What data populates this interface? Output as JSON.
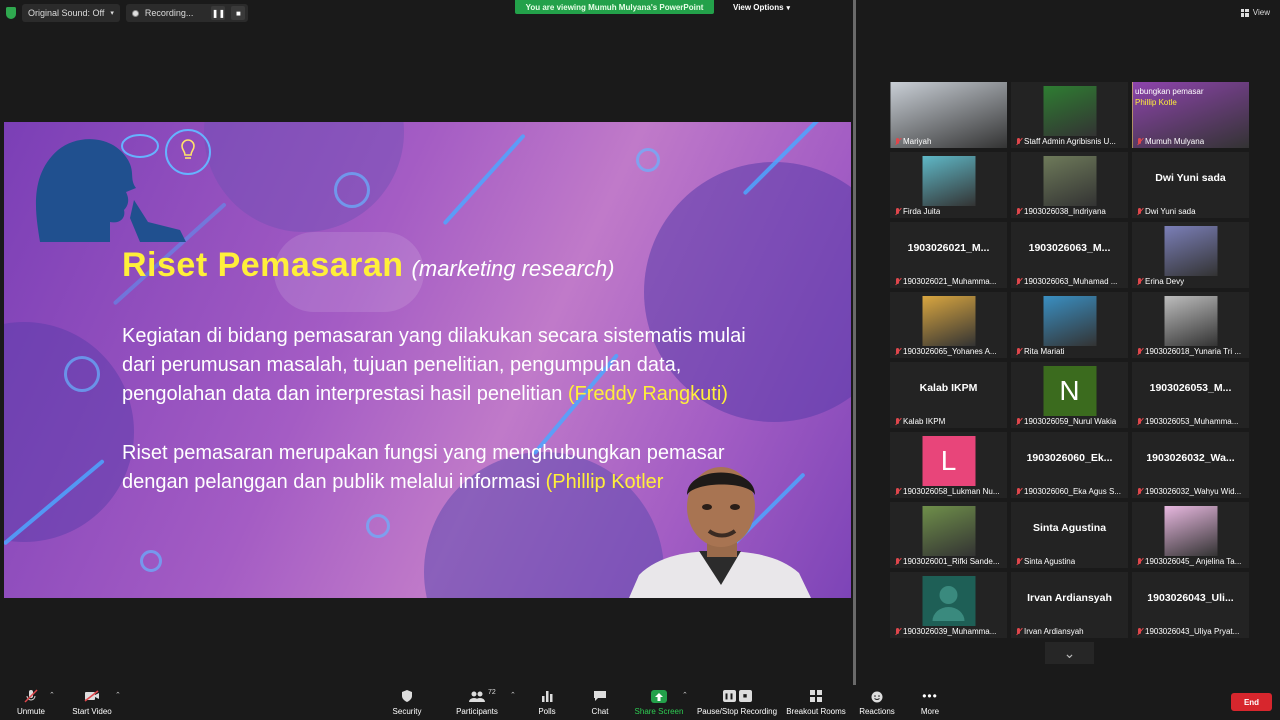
{
  "topbar": {
    "original_sound": "Original Sound: Off",
    "recording": "Recording...",
    "viewing_banner": "You are viewing Mumuh Mulyana's PowerPoint",
    "view_options": "View Options",
    "view": "View"
  },
  "slide": {
    "title": "Riset Pemasaran",
    "title_sub": "(marketing research)",
    "para1": "Kegiatan di bidang pemasaran yang dilakukan secara sistematis mulai dari perumusan masalah, tujuan penelitian, pengumpulan data, pengolahan data dan interprestasi hasil penelitian",
    "ref1": "(Freddy Rangkuti)",
    "para2": "Riset pemasaran merupakan fungsi yang menghubungkan pemasar dengan pelanggan dan publik melalui informasi",
    "ref2": "(Phillip Kotler"
  },
  "participants": [
    {
      "name": "Mariyah",
      "type": "photo",
      "color": "#c9cfd6"
    },
    {
      "name": "Staff Admin Agribisnis U...",
      "type": "photo",
      "color": "#2e7d32"
    },
    {
      "name": "Mumuh Mulyana",
      "type": "photo",
      "color": "#8e44ad",
      "overlay": "ubungkan pemasar",
      "overlay2": "Phillip Kotle"
    },
    {
      "name": "Firda Juita",
      "type": "photo",
      "color": "#5fb8c7"
    },
    {
      "name": "1903026038_Indriyana",
      "type": "photo",
      "color": "#6e7a5a"
    },
    {
      "name": "Dwi Yuni sada",
      "type": "text",
      "big": "Dwi Yuni sada"
    },
    {
      "name": "1903026021_Muhamma...",
      "type": "text",
      "big": "1903026021_M..."
    },
    {
      "name": "1903026063_Muhamad ...",
      "type": "text",
      "big": "1903026063_M..."
    },
    {
      "name": "Erina Devy",
      "type": "photo",
      "color": "#7b7fb8"
    },
    {
      "name": "1903026065_Yohanes A...",
      "type": "photo",
      "color": "#d9a640"
    },
    {
      "name": "Rita Mariati",
      "type": "photo",
      "color": "#3a8fc2"
    },
    {
      "name": "1903026018_Yunaria Tri ...",
      "type": "photo",
      "color": "#bdbdbd"
    },
    {
      "name": "Kalab IKPM",
      "type": "text",
      "big": "Kalab IKPM"
    },
    {
      "name": "1903026059_Nurul Wakia",
      "type": "letter",
      "letter": "N",
      "color": "#3b6b1e"
    },
    {
      "name": "1903026053_Muhamma...",
      "type": "text",
      "big": "1903026053_M..."
    },
    {
      "name": "1903026058_Lukman Nu...",
      "type": "letter",
      "letter": "L",
      "color": "#e8457a"
    },
    {
      "name": "1903026060_Eka Agus S...",
      "type": "text",
      "big": "1903026060_Ek..."
    },
    {
      "name": "1903026032_Wahyu Wid...",
      "type": "text",
      "big": "1903026032_Wa..."
    },
    {
      "name": "1903026001_Rifki Sande...",
      "type": "photo",
      "color": "#6f8f4a"
    },
    {
      "name": "Sinta Agustina",
      "type": "text",
      "big": "Sinta Agustina"
    },
    {
      "name": "1903026045_ Anjelina Ta...",
      "type": "photo",
      "color": "#e8b8e0"
    },
    {
      "name": "1903026039_Muhamma...",
      "type": "avatar",
      "color": "#1e5f56"
    },
    {
      "name": "Irvan Ardiansyah",
      "type": "text",
      "big": "Irvan Ardiansyah"
    },
    {
      "name": "1903026043_Uliya Pryat...",
      "type": "text",
      "big": "1903026043_Uli..."
    }
  ],
  "toolbar": {
    "unmute": "Unmute",
    "start_video": "Start Video",
    "security": "Security",
    "participants": "Participants",
    "participants_count": "72",
    "polls": "Polls",
    "chat": "Chat",
    "share_screen": "Share Screen",
    "pause_recording": "Pause/Stop Recording",
    "breakout": "Breakout Rooms",
    "reactions": "Reactions",
    "more": "More",
    "end": "End"
  }
}
